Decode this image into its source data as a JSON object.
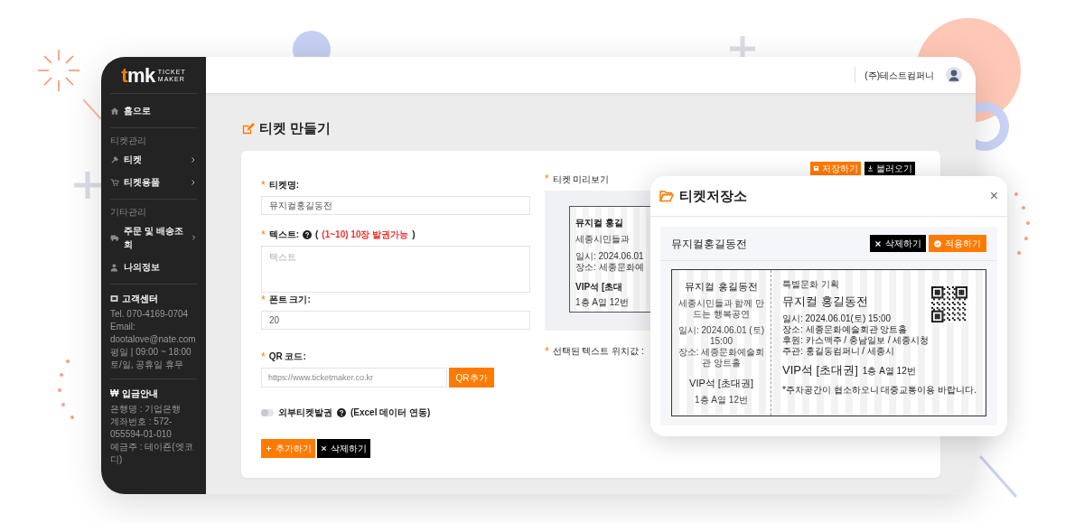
{
  "sidebar": {
    "logo": {
      "mark_first": "t",
      "mark_rest": "mk",
      "line1": "TICKET",
      "line2": "MAKER"
    },
    "home": "홈으로",
    "sections": [
      {
        "title": "티켓관리",
        "items": [
          {
            "label": "티켓",
            "submenu": true
          },
          {
            "label": "티켓용품",
            "submenu": true
          }
        ]
      },
      {
        "title": "기타관리",
        "items": [
          {
            "label": "주문 및 배송조회",
            "submenu": true
          },
          {
            "label": "나의정보",
            "submenu": false
          }
        ]
      }
    ],
    "support": {
      "title": "고객센터",
      "lines": [
        "Tel. 070-4169-0704",
        "Email: dootalove@nate.com",
        "평일 | 09:00 ~ 18:00",
        "토/일, 공휴일 휴무"
      ]
    },
    "deposit": {
      "symbol": "₩",
      "title": "입금안내",
      "lines": [
        "은행명 : 기업은행",
        "계좌번호 : 572-055594-01-010",
        "예금주 : 테이죤(엣코디)"
      ]
    }
  },
  "topbar": {
    "company": "(주)테스트컴퍼니"
  },
  "page_title": "티켓 만들기",
  "form": {
    "fields": [
      {
        "kind": "input",
        "mark": "*",
        "label": "티켓명:",
        "value": "뮤지컬홍길동전"
      },
      {
        "kind": "textarea",
        "mark": "*",
        "label": "텍스트:",
        "note_open": "(",
        "note": "(1~10) 10장 발권가능",
        "note_close": ")",
        "placeholder": "텍스트"
      },
      {
        "kind": "input",
        "mark": "*",
        "label": "폰트 크기:",
        "value": "20"
      },
      {
        "kind": "qr",
        "mark": "*",
        "label": "QR 코드:",
        "placeholder": "https://www.ticketmaker.co.kr",
        "button": "QR추가"
      }
    ],
    "toggle": {
      "label": "외부티켓발권",
      "note": "(Excel 데이터 연동)",
      "on": false
    },
    "buttons": [
      {
        "kind": "add",
        "label": "추가하기"
      },
      {
        "kind": "delete",
        "label": "삭제하기"
      }
    ]
  },
  "preview": {
    "title_mark": "*",
    "title": "티켓 미리보기",
    "buttons": [
      {
        "kind": "save",
        "label": "저장하기"
      },
      {
        "kind": "load",
        "label": "불러오기"
      }
    ],
    "ticket": {
      "title": "뮤지컬 홍길",
      "subtitle": "세종시민들과",
      "date": "일시: 2024.06.01",
      "place": "장소: 세종문화예",
      "seat": "VIP석 [초대",
      "seat_no": "1층 A열 12번"
    },
    "position_mark": "*",
    "position_label": "선택된 텍스트 위치값 :"
  },
  "modal": {
    "title": "티켓저장소",
    "close": "×",
    "items": [
      {
        "name": "뮤지컬홍길동전",
        "buttons": [
          {
            "kind": "delete",
            "label": "삭제하기"
          },
          {
            "kind": "apply",
            "label": "적용하기"
          }
        ],
        "ticket": {
          "stub": {
            "title": "뮤지컬 홍길동전",
            "subtitle": "세종시민들과 함께 만드는 행복공연",
            "date": "일시: 2024.06.01 (토) 15:00",
            "place": "장소: 세종문화예술회관 앙트홀",
            "seat": "VIP석 [초대권]",
            "seat_no": "1층 A열 12번"
          },
          "main": {
            "category": "특별문화 기획",
            "title": "뮤지컬 홍길동전",
            "lines": [
              "일시: 2024.06.01(토) 15:00",
              "장소: 세종문화예술회관 앙트홀",
              "후원: 카스맥주 / 충남일보 / 세종시청",
              "주관: 홍길동컴퍼니 / 세종시"
            ],
            "seat": "VIP석 [초대권]",
            "seat_no": "1층 A열 12번",
            "note": "*주차공간이 협소하오니 대중교통이용 바랍니다."
          }
        }
      }
    ]
  }
}
